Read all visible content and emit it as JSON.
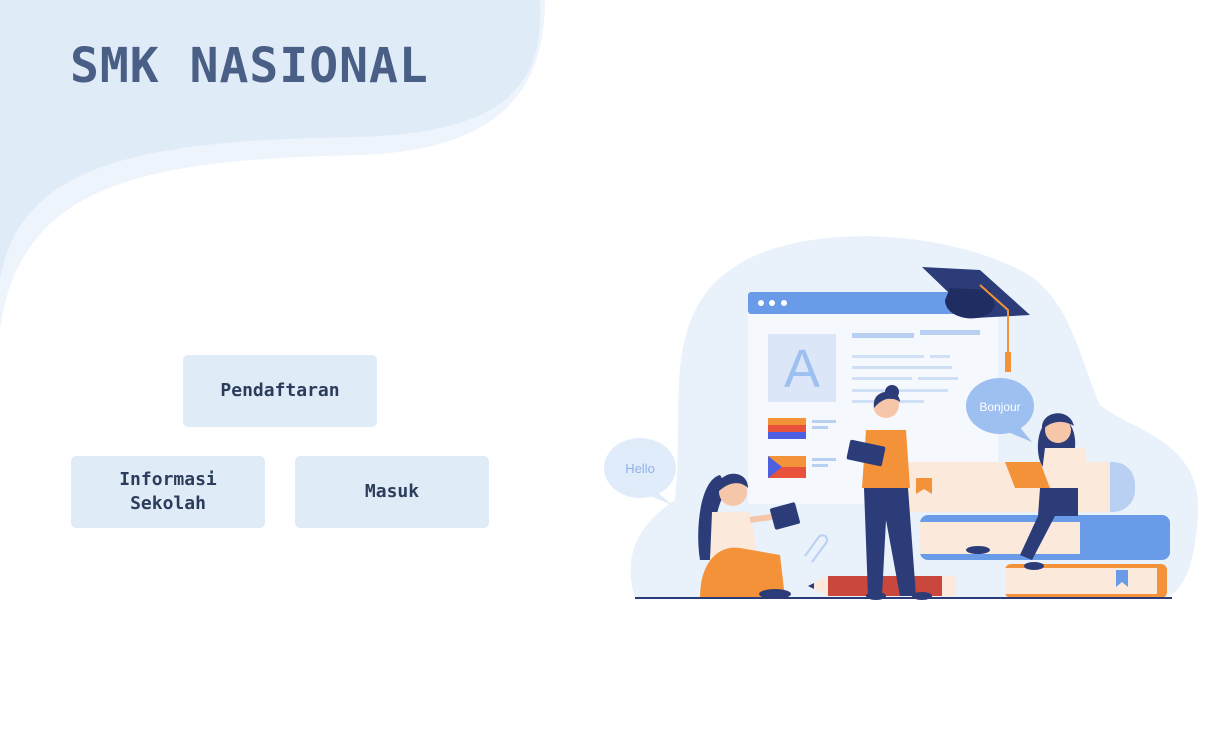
{
  "header": {
    "title": "SMK NASIONAL"
  },
  "menu": {
    "register_label": "Pendaftaran",
    "info_label_line1": "Informasi",
    "info_label_line2": "Sekolah",
    "login_label": "Masuk"
  },
  "illustration": {
    "bubble_left_text": "Hello",
    "bubble_right_text": "Bonjour",
    "letter": "A"
  },
  "colors": {
    "title": "#4a5f86",
    "button_bg": "#e0ebf8",
    "button_text": "#2c3d5c",
    "accent_blue": "#6a9be8",
    "accent_orange": "#f4923a",
    "navy": "#2b3c78"
  }
}
